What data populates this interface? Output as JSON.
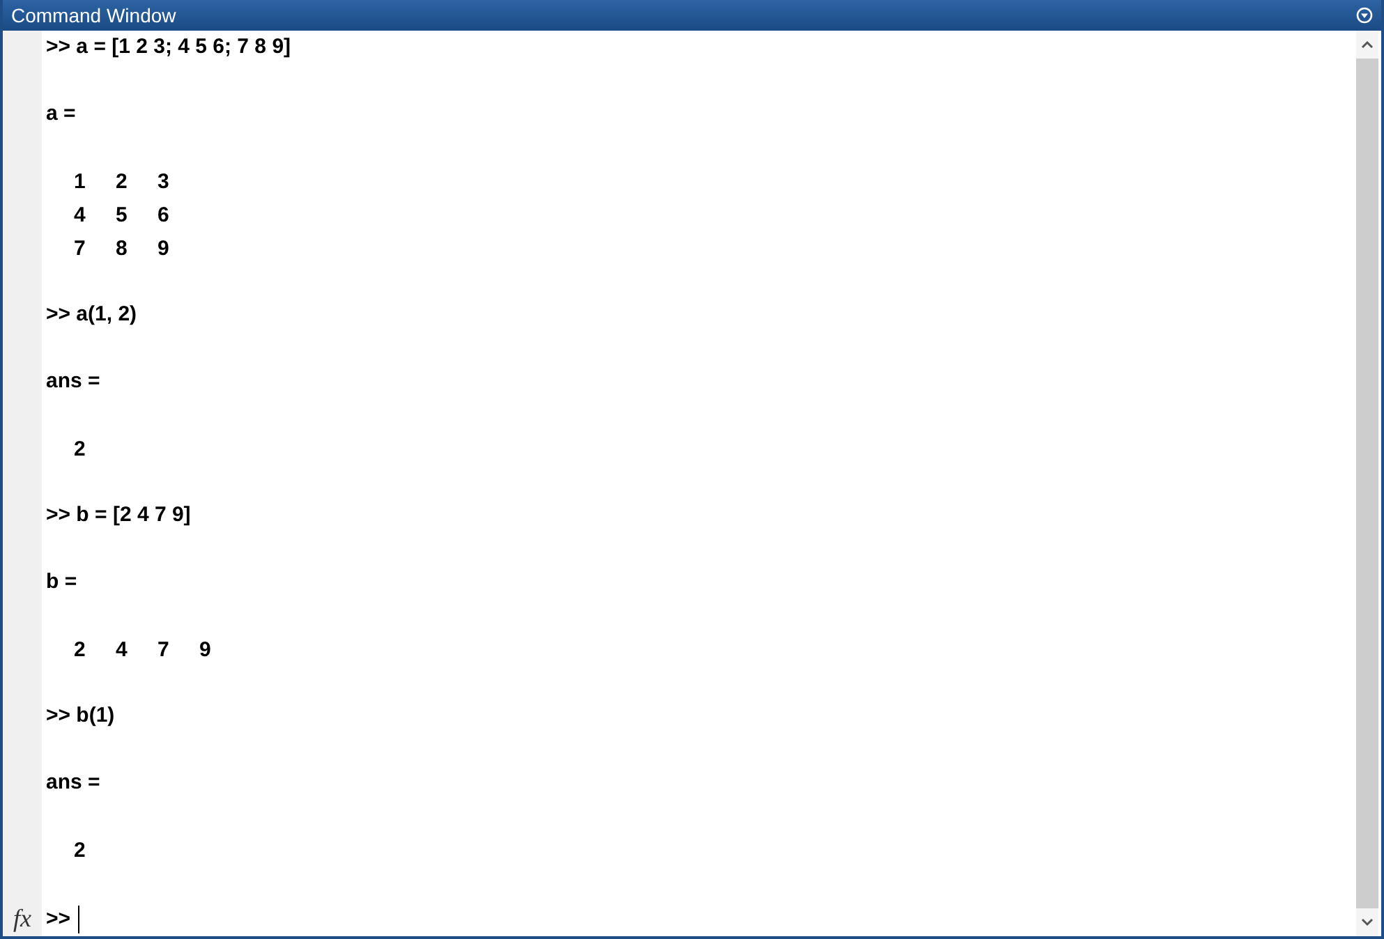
{
  "window": {
    "title": "Command Window"
  },
  "blocks": [
    {
      "kind": "command",
      "text": ">> a = [1 2 3; 4 5 6; 7 8 9]"
    },
    {
      "kind": "output",
      "text": "a ="
    },
    {
      "kind": "matrix",
      "rows": [
        [
          "1",
          "2",
          "3"
        ],
        [
          "4",
          "5",
          "6"
        ],
        [
          "7",
          "8",
          "9"
        ]
      ]
    },
    {
      "kind": "command",
      "text": ">> a(1, 2)"
    },
    {
      "kind": "output",
      "text": "ans ="
    },
    {
      "kind": "matrix",
      "rows": [
        [
          "2"
        ]
      ]
    },
    {
      "kind": "command",
      "text": ">> b = [2 4 7 9]"
    },
    {
      "kind": "output",
      "text": "b ="
    },
    {
      "kind": "matrix",
      "rows": [
        [
          "2",
          "4",
          "7",
          "9"
        ]
      ]
    },
    {
      "kind": "command",
      "text": ">> b(1)"
    },
    {
      "kind": "output",
      "text": "ans ="
    },
    {
      "kind": "matrix",
      "rows": [
        [
          "2"
        ]
      ]
    }
  ],
  "prompt": {
    "fx_label": "fx",
    "text": ">>"
  }
}
